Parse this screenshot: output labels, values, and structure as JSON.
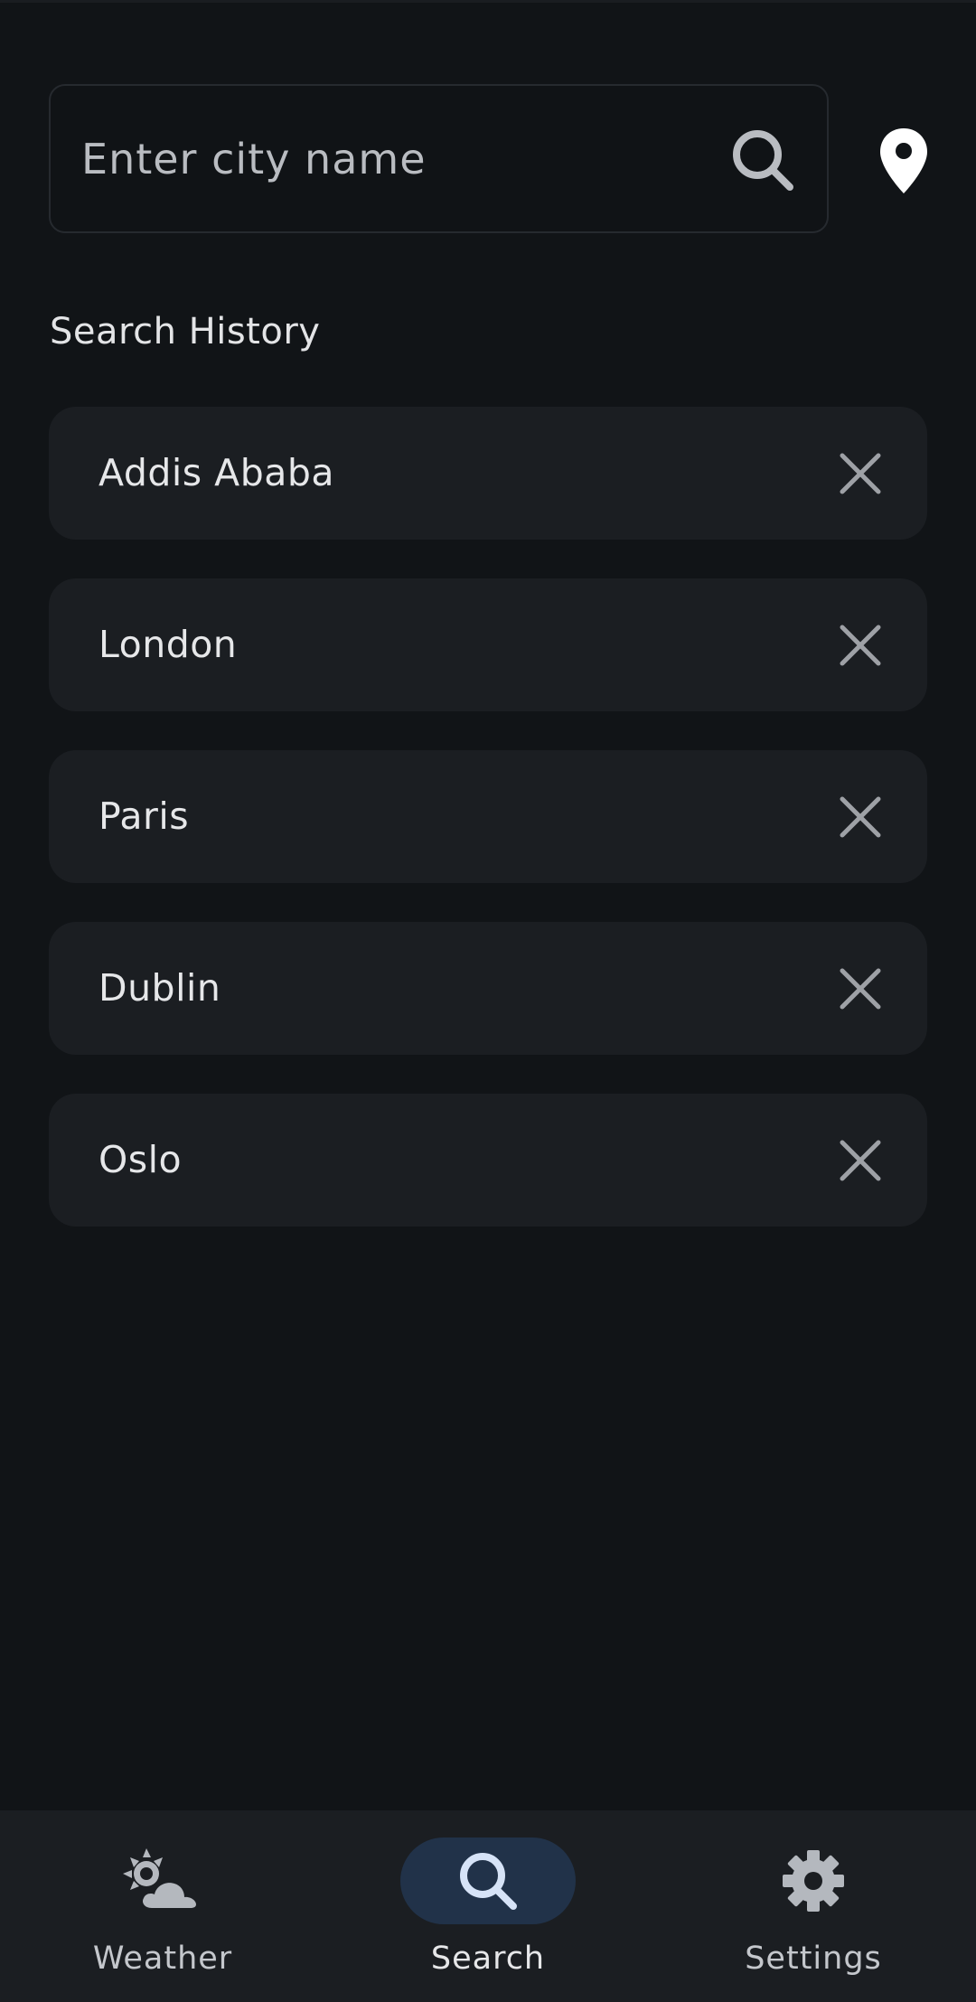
{
  "search": {
    "placeholder": "Enter city name",
    "value": "",
    "search_icon": "search-icon",
    "location_icon": "map-pin-icon"
  },
  "history": {
    "title": "Search History",
    "items": [
      {
        "label": "Addis Ababa"
      },
      {
        "label": "London"
      },
      {
        "label": "Paris"
      },
      {
        "label": "Dublin"
      },
      {
        "label": "Oslo"
      }
    ],
    "remove_icon": "close-icon"
  },
  "nav": {
    "items": [
      {
        "label": "Weather",
        "icon": "weather-partly-cloudy-icon",
        "active": false
      },
      {
        "label": "Search",
        "icon": "search-icon",
        "active": true
      },
      {
        "label": "Settings",
        "icon": "gear-icon",
        "active": false
      }
    ]
  },
  "colors": {
    "background": "#111417",
    "card": "#1b1e22",
    "active_pill": "#213249",
    "text": "#e3e4e6",
    "icon_muted": "#9ea1a6"
  }
}
